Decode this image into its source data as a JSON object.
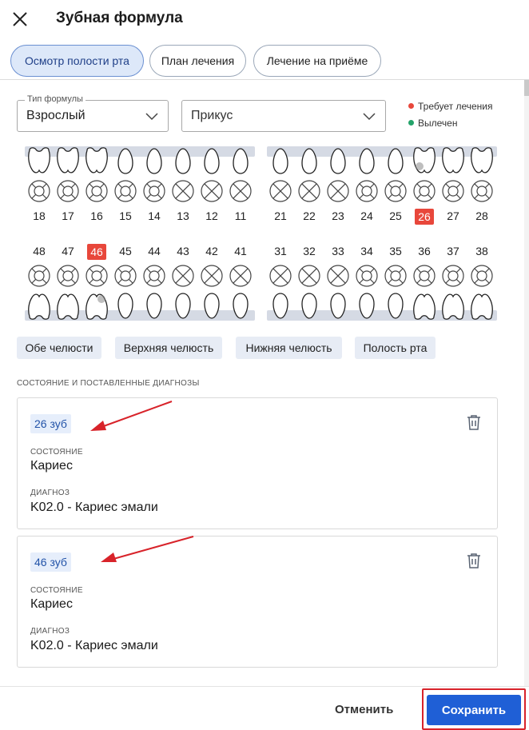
{
  "header": {
    "title": "Зубная формула"
  },
  "tabs": [
    {
      "label": "Осмотр полости рта",
      "active": true
    },
    {
      "label": "План лечения",
      "active": false
    },
    {
      "label": "Лечение на приёме",
      "active": false
    }
  ],
  "formula_type": {
    "label": "Тип формулы",
    "value": "Взрослый"
  },
  "bite": {
    "placeholder": "Прикус"
  },
  "legend": [
    {
      "label": "Требует лечения",
      "color": "#e8473b"
    },
    {
      "label": "Вылечен",
      "color": "#24a36a"
    }
  ],
  "upper_row": {
    "numbers": [
      "18",
      "17",
      "16",
      "15",
      "14",
      "13",
      "12",
      "11",
      "21",
      "22",
      "23",
      "24",
      "25",
      "26",
      "27",
      "28"
    ],
    "highlighted": "26",
    "shapes": [
      "molar",
      "molar",
      "molar",
      "single",
      "single",
      "single",
      "single",
      "single",
      "single",
      "single",
      "single",
      "single",
      "single",
      "molar",
      "molar",
      "molar"
    ],
    "symbols": [
      "ring",
      "ring",
      "ring",
      "ring",
      "ring",
      "cross",
      "cross",
      "cross",
      "cross",
      "cross",
      "cross",
      "ring",
      "ring",
      "ring",
      "ring",
      "ring"
    ],
    "caries": [
      "26"
    ]
  },
  "lower_row": {
    "numbers": [
      "48",
      "47",
      "46",
      "45",
      "44",
      "43",
      "42",
      "41",
      "31",
      "32",
      "33",
      "34",
      "35",
      "36",
      "37",
      "38"
    ],
    "highlighted": "46",
    "shapes": [
      "molar",
      "molar",
      "molar",
      "single",
      "single",
      "single",
      "single",
      "single",
      "single",
      "single",
      "single",
      "single",
      "single",
      "molar",
      "molar",
      "molar"
    ],
    "symbols": [
      "ring",
      "ring",
      "ring",
      "ring",
      "ring",
      "cross",
      "cross",
      "cross",
      "cross",
      "cross",
      "cross",
      "ring",
      "ring",
      "ring",
      "ring",
      "ring"
    ],
    "caries": [
      "46"
    ]
  },
  "jaw_chips": [
    "Обе челюсти",
    "Верхняя челюсть",
    "Нижняя челюсть",
    "Полость рта"
  ],
  "section_title": "СОСТОЯНИЕ И ПОСТАВЛЕННЫЕ ДИАГНОЗЫ",
  "cards": [
    {
      "tooth": "26 зуб",
      "state_label": "СОСТОЯНИЕ",
      "state": "Кариес",
      "diag_label": "ДИАГНОЗ",
      "diag": "K02.0 - Кариес эмали"
    },
    {
      "tooth": "46 зуб",
      "state_label": "СОСТОЯНИЕ",
      "state": "Кариес",
      "diag_label": "ДИАГНОЗ",
      "diag": "K02.0 - Кариес эмали"
    }
  ],
  "footer": {
    "cancel": "Отменить",
    "save": "Сохранить"
  },
  "colors": {
    "accent": "#1f5fd6",
    "highlight": "#e8473b",
    "annotation": "#d8232a"
  }
}
